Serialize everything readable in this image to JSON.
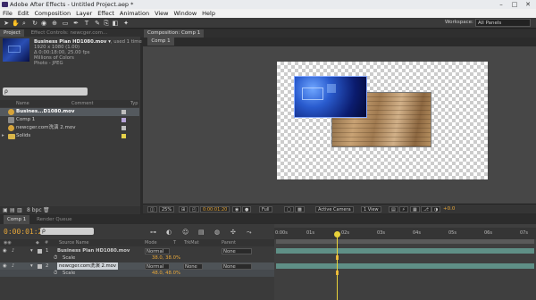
{
  "window": {
    "title": "Adobe After Effects - Untitled Project.aep *",
    "min": "–",
    "max": "□",
    "close": "✕"
  },
  "menu": [
    "File",
    "Edit",
    "Composition",
    "Layer",
    "Effect",
    "Animation",
    "View",
    "Window",
    "Help"
  ],
  "toolbar": {
    "workspace_label": "Workspace:",
    "workspace_value": "All Panels"
  },
  "project_panel": {
    "tab_project": "Project",
    "tab_effect_controls": "Effect Controls: newcger.com...",
    "selected_name": "Business Plan HD1080.mov ▾",
    "used": ", used 1 time",
    "info": [
      "1920 x 1080 (1.00)",
      "Δ 0:00:18:00, 25.00 fps",
      "Millions of Colors",
      "Photo - JPEG"
    ],
    "search_placeholder": "ρ",
    "col_name": "Name",
    "col_comment": "Comment",
    "col_type": "Typ",
    "items": [
      {
        "name": "Busines...D1080.mov"
      },
      {
        "name": "Comp 1"
      },
      {
        "name": "newcger.com洗演 2.mov"
      },
      {
        "name": "Solids"
      }
    ],
    "bpc": "8 bpc"
  },
  "composition": {
    "tab": "Composition: Comp 1",
    "subtab": "Comp 1",
    "zoom": "25%",
    "timecode": "0:00:01:20",
    "resolution": "Full",
    "camera": "Active Camera",
    "views": "1 View",
    "exposure": "+0.0"
  },
  "timeline": {
    "tab_comp": "Comp 1",
    "tab_render": "Render Queue",
    "current_time": "0:00:01:20",
    "col_source": "Source Name",
    "col_mode": "Mode",
    "col_t": "T",
    "col_trkmat": "TrkMat",
    "col_parent": "Parent",
    "ruler_labels": [
      "0:00s",
      "01s",
      "02s",
      "03s",
      "04s",
      "05s",
      "06s",
      "07s"
    ],
    "layers": [
      {
        "num": "1",
        "name": "Business Plan HD1080.mov",
        "mode": "Normal",
        "parent": "None",
        "prop": "Scale",
        "value": "38.0, 38.0%"
      },
      {
        "num": "2",
        "name": "newcger.com洗演 2.mov",
        "mode": "Normal",
        "trkmat": "None",
        "parent": "None",
        "prop": "Scale",
        "value": "48.0, 48.0%"
      }
    ]
  },
  "colors": {
    "accent_orange": "#e8a83a",
    "playhead": "#e8d23a",
    "layer_bar": "#5f8f86",
    "panel": "#3a3a3a"
  }
}
